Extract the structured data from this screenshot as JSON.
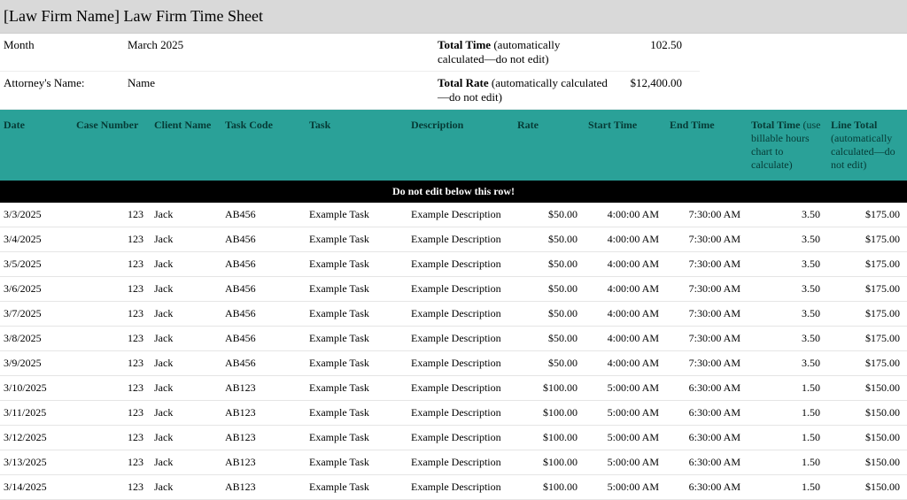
{
  "title": "[Law Firm Name] Law Firm Time Sheet",
  "meta": {
    "month_label": "Month",
    "month_value": "March 2025",
    "attorney_label": "Attorney's Name:",
    "attorney_value": "Name",
    "total_time_label_bold": "Total Time",
    "total_time_label_rest": " (automatically calculated—do not edit)",
    "total_time_value": "102.50",
    "total_rate_label_bold": "Total Rate",
    "total_rate_label_rest": " (automatically calculated—do not edit)",
    "total_rate_value": "$12,400.00"
  },
  "headers": {
    "date": "Date",
    "case_number": "Case Number",
    "client_name": "Client Name",
    "task_code": "Task Code",
    "task": "Task",
    "description": "Description",
    "rate": "Rate",
    "start_time": "Start Time",
    "end_time": "End Time",
    "total_time_bold": "Total Time",
    "total_time_rest": " (use billable hours chart to calculate)",
    "line_total_bold": "Line Total",
    "line_total_rest": " (automatically calculated—do not edit)"
  },
  "warning": "Do not edit below this row!",
  "rows": [
    {
      "date": "3/3/2025",
      "case": "123",
      "client": "Jack",
      "code": "AB456",
      "task": "Example Task",
      "desc": "Example Description",
      "rate": "$50.00",
      "start": "4:00:00 AM",
      "end": "7:30:00 AM",
      "tt": "3.50",
      "lt": "$175.00"
    },
    {
      "date": "3/4/2025",
      "case": "123",
      "client": "Jack",
      "code": "AB456",
      "task": "Example Task",
      "desc": "Example Description",
      "rate": "$50.00",
      "start": "4:00:00 AM",
      "end": "7:30:00 AM",
      "tt": "3.50",
      "lt": "$175.00"
    },
    {
      "date": "3/5/2025",
      "case": "123",
      "client": "Jack",
      "code": "AB456",
      "task": "Example Task",
      "desc": "Example Description",
      "rate": "$50.00",
      "start": "4:00:00 AM",
      "end": "7:30:00 AM",
      "tt": "3.50",
      "lt": "$175.00"
    },
    {
      "date": "3/6/2025",
      "case": "123",
      "client": "Jack",
      "code": "AB456",
      "task": "Example Task",
      "desc": "Example Description",
      "rate": "$50.00",
      "start": "4:00:00 AM",
      "end": "7:30:00 AM",
      "tt": "3.50",
      "lt": "$175.00"
    },
    {
      "date": "3/7/2025",
      "case": "123",
      "client": "Jack",
      "code": "AB456",
      "task": "Example Task",
      "desc": "Example Description",
      "rate": "$50.00",
      "start": "4:00:00 AM",
      "end": "7:30:00 AM",
      "tt": "3.50",
      "lt": "$175.00"
    },
    {
      "date": "3/8/2025",
      "case": "123",
      "client": "Jack",
      "code": "AB456",
      "task": "Example Task",
      "desc": "Example Description",
      "rate": "$50.00",
      "start": "4:00:00 AM",
      "end": "7:30:00 AM",
      "tt": "3.50",
      "lt": "$175.00"
    },
    {
      "date": "3/9/2025",
      "case": "123",
      "client": "Jack",
      "code": "AB456",
      "task": "Example Task",
      "desc": "Example Description",
      "rate": "$50.00",
      "start": "4:00:00 AM",
      "end": "7:30:00 AM",
      "tt": "3.50",
      "lt": "$175.00"
    },
    {
      "date": "3/10/2025",
      "case": "123",
      "client": "Jack",
      "code": "AB123",
      "task": "Example Task",
      "desc": "Example Description",
      "rate": "$100.00",
      "start": "5:00:00 AM",
      "end": "6:30:00 AM",
      "tt": "1.50",
      "lt": "$150.00"
    },
    {
      "date": "3/11/2025",
      "case": "123",
      "client": "Jack",
      "code": "AB123",
      "task": "Example Task",
      "desc": "Example Description",
      "rate": "$100.00",
      "start": "5:00:00 AM",
      "end": "6:30:00 AM",
      "tt": "1.50",
      "lt": "$150.00"
    },
    {
      "date": "3/12/2025",
      "case": "123",
      "client": "Jack",
      "code": "AB123",
      "task": "Example Task",
      "desc": "Example Description",
      "rate": "$100.00",
      "start": "5:00:00 AM",
      "end": "6:30:00 AM",
      "tt": "1.50",
      "lt": "$150.00"
    },
    {
      "date": "3/13/2025",
      "case": "123",
      "client": "Jack",
      "code": "AB123",
      "task": "Example Task",
      "desc": "Example Description",
      "rate": "$100.00",
      "start": "5:00:00 AM",
      "end": "6:30:00 AM",
      "tt": "1.50",
      "lt": "$150.00"
    },
    {
      "date": "3/14/2025",
      "case": "123",
      "client": "Jack",
      "code": "AB123",
      "task": "Example Task",
      "desc": "Example Description",
      "rate": "$100.00",
      "start": "5:00:00 AM",
      "end": "6:30:00 AM",
      "tt": "1.50",
      "lt": "$150.00"
    }
  ]
}
